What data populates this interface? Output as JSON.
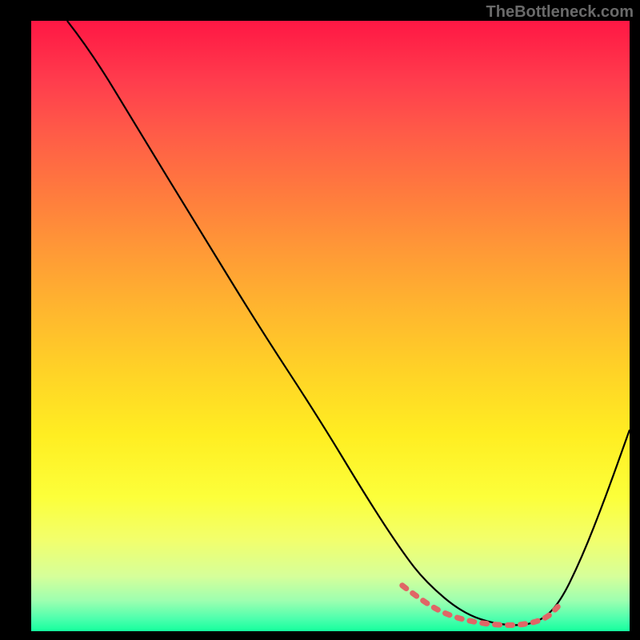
{
  "watermark": "TheBottleneck.com",
  "chart_data": {
    "type": "line",
    "title": "",
    "xlabel": "",
    "ylabel": "",
    "x_range_pct": [
      0,
      100
    ],
    "y_range_pct": [
      0,
      100
    ],
    "series": [
      {
        "name": "main-curve",
        "color": "#000000",
        "x_pct": [
          6,
          10,
          18,
          28,
          38,
          48,
          56,
          62,
          66,
          72,
          78,
          84,
          88,
          92,
          96,
          100
        ],
        "y_pct": [
          100,
          95,
          82,
          66,
          50,
          35,
          22,
          13,
          8,
          3,
          1,
          1,
          4,
          12,
          22,
          33
        ]
      },
      {
        "name": "highlight-segment",
        "color": "#e06666",
        "style": "dashed",
        "x_pct": [
          62,
          66,
          70,
          74,
          78,
          82,
          86,
          88
        ],
        "y_pct": [
          7.5,
          4.5,
          2.5,
          1.5,
          1.0,
          1.0,
          2.0,
          4.0
        ]
      }
    ],
    "notes": "Axes have no visible tick labels or numeric scale; values given as percent of plot width/height. y_pct measured from bottom (0) to top (100)."
  }
}
